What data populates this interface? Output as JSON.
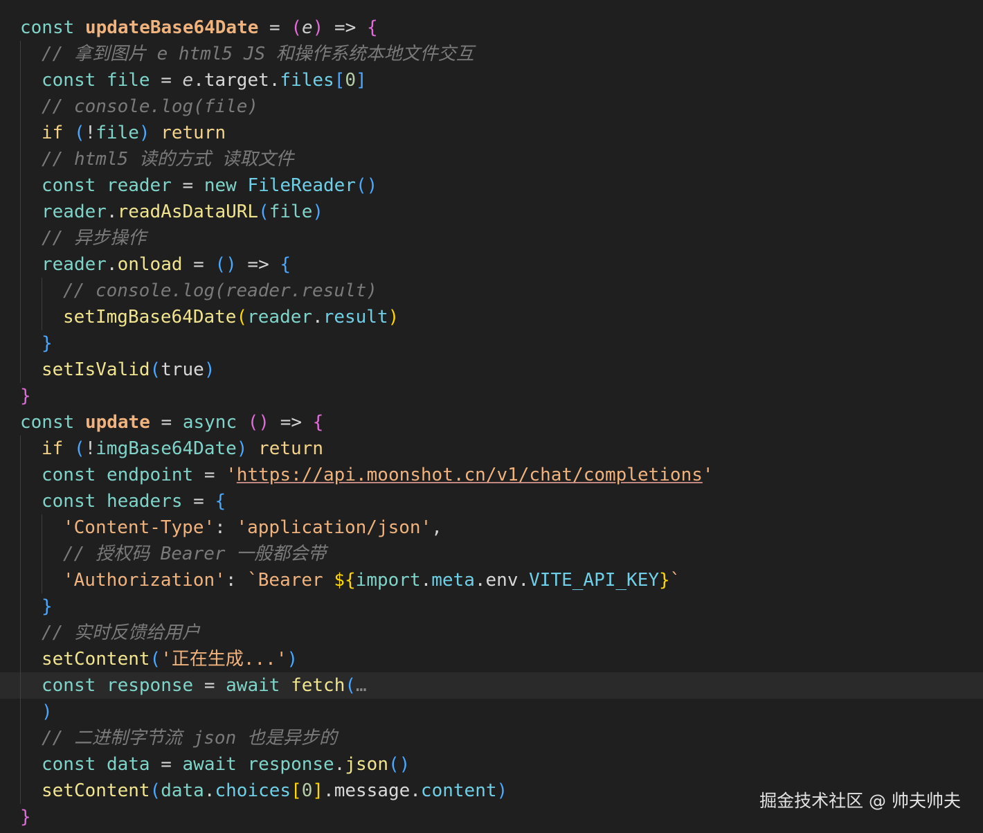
{
  "editor": {
    "lines": [
      {
        "indent": 0,
        "tokens": [
          [
            "kw-const",
            "const"
          ],
          [
            "op",
            " "
          ],
          [
            "fn-decl",
            "updateBase64Date"
          ],
          [
            "op",
            " = "
          ],
          [
            "p1",
            "("
          ],
          [
            "param",
            "e"
          ],
          [
            "p1",
            ")"
          ],
          [
            "op",
            " => "
          ],
          [
            "p1",
            "{"
          ]
        ]
      },
      {
        "indent": 1,
        "tokens": [
          [
            "cmt",
            "// 拿到图片 e html5 JS 和操作系统本地文件交互"
          ]
        ]
      },
      {
        "indent": 1,
        "tokens": [
          [
            "kw-const",
            "const"
          ],
          [
            "op",
            " "
          ],
          [
            "var",
            "file"
          ],
          [
            "op",
            " = "
          ],
          [
            "param",
            "e"
          ],
          [
            "op",
            "."
          ],
          [
            "plain",
            "target"
          ],
          [
            "op",
            "."
          ],
          [
            "prop",
            "files"
          ],
          [
            "p2",
            "["
          ],
          [
            "num",
            "0"
          ],
          [
            "p2",
            "]"
          ]
        ]
      },
      {
        "indent": 1,
        "tokens": [
          [
            "cmt",
            "// console.log(file)"
          ]
        ]
      },
      {
        "indent": 1,
        "tokens": [
          [
            "kw-ctrl",
            "if"
          ],
          [
            "op",
            " "
          ],
          [
            "p2",
            "("
          ],
          [
            "op",
            "!"
          ],
          [
            "var",
            "file"
          ],
          [
            "p2",
            ")"
          ],
          [
            "op",
            " "
          ],
          [
            "kw-ctrl",
            "return"
          ]
        ]
      },
      {
        "indent": 1,
        "tokens": [
          [
            "cmt",
            "// html5 读的方式 读取文件"
          ]
        ]
      },
      {
        "indent": 1,
        "tokens": [
          [
            "kw-const",
            "const"
          ],
          [
            "op",
            " "
          ],
          [
            "var",
            "reader"
          ],
          [
            "op",
            " = "
          ],
          [
            "kw-const",
            "new"
          ],
          [
            "op",
            " "
          ],
          [
            "cls",
            "FileReader"
          ],
          [
            "p2",
            "()"
          ]
        ]
      },
      {
        "indent": 1,
        "tokens": [
          [
            "var",
            "reader"
          ],
          [
            "op",
            "."
          ],
          [
            "fn-call",
            "readAsDataURL"
          ],
          [
            "p2",
            "("
          ],
          [
            "var",
            "file"
          ],
          [
            "p2",
            ")"
          ]
        ]
      },
      {
        "indent": 1,
        "tokens": [
          [
            "cmt",
            "// 异步操作"
          ]
        ]
      },
      {
        "indent": 1,
        "tokens": [
          [
            "var",
            "reader"
          ],
          [
            "op",
            "."
          ],
          [
            "fn-call",
            "onload"
          ],
          [
            "op",
            " = "
          ],
          [
            "p2",
            "()"
          ],
          [
            "op",
            " => "
          ],
          [
            "p2",
            "{"
          ]
        ]
      },
      {
        "indent": 2,
        "tokens": [
          [
            "cmt",
            "// console.log(reader.result)"
          ]
        ]
      },
      {
        "indent": 2,
        "tokens": [
          [
            "fn-call",
            "setImgBase64Date"
          ],
          [
            "p3",
            "("
          ],
          [
            "var",
            "reader"
          ],
          [
            "op",
            "."
          ],
          [
            "prop",
            "result"
          ],
          [
            "p3",
            ")"
          ]
        ]
      },
      {
        "indent": 1,
        "tokens": [
          [
            "p2",
            "}"
          ]
        ]
      },
      {
        "indent": 1,
        "tokens": [
          [
            "fn-call",
            "setIsValid"
          ],
          [
            "p2",
            "("
          ],
          [
            "plain",
            "true"
          ],
          [
            "p2",
            ")"
          ]
        ]
      },
      {
        "indent": 0,
        "tokens": [
          [
            "p1",
            "}"
          ]
        ]
      },
      {
        "indent": 0,
        "tokens": [
          [
            "kw-const",
            "const"
          ],
          [
            "op",
            " "
          ],
          [
            "fn-decl",
            "update"
          ],
          [
            "op",
            " = "
          ],
          [
            "kw-const",
            "async"
          ],
          [
            "op",
            " "
          ],
          [
            "p1",
            "()"
          ],
          [
            "op",
            " => "
          ],
          [
            "p1",
            "{"
          ]
        ]
      },
      {
        "indent": 1,
        "tokens": [
          [
            "kw-ctrl",
            "if"
          ],
          [
            "op",
            " "
          ],
          [
            "p2",
            "("
          ],
          [
            "op",
            "!"
          ],
          [
            "var",
            "imgBase64Date"
          ],
          [
            "p2",
            ")"
          ],
          [
            "op",
            " "
          ],
          [
            "kw-ctrl",
            "return"
          ]
        ]
      },
      {
        "indent": 1,
        "tokens": [
          [
            "kw-const",
            "const"
          ],
          [
            "op",
            " "
          ],
          [
            "var",
            "endpoint"
          ],
          [
            "op",
            " = "
          ],
          [
            "str",
            "'"
          ],
          [
            "url",
            "https://api.moonshot.cn/v1/chat/completions"
          ],
          [
            "str",
            "'"
          ]
        ]
      },
      {
        "indent": 1,
        "tokens": [
          [
            "kw-const",
            "const"
          ],
          [
            "op",
            " "
          ],
          [
            "var",
            "headers"
          ],
          [
            "op",
            " = "
          ],
          [
            "p2",
            "{"
          ]
        ]
      },
      {
        "indent": 2,
        "tokens": [
          [
            "str",
            "'Content-Type'"
          ],
          [
            "op",
            ": "
          ],
          [
            "str",
            "'application/json'"
          ],
          [
            "op",
            ","
          ]
        ]
      },
      {
        "indent": 2,
        "tokens": [
          [
            "cmt",
            "// 授权码 Bearer 一般都会带"
          ]
        ]
      },
      {
        "indent": 2,
        "tokens": [
          [
            "str",
            "'Authorization'"
          ],
          [
            "op",
            ": "
          ],
          [
            "str",
            "`Bearer "
          ],
          [
            "p3",
            "${"
          ],
          [
            "var",
            "import"
          ],
          [
            "op",
            "."
          ],
          [
            "prop",
            "meta"
          ],
          [
            "op",
            "."
          ],
          [
            "plain",
            "env"
          ],
          [
            "op",
            "."
          ],
          [
            "prop",
            "VITE_API_KEY"
          ],
          [
            "p3",
            "}"
          ],
          [
            "str",
            "`"
          ]
        ]
      },
      {
        "indent": 1,
        "tokens": [
          [
            "p2",
            "}"
          ]
        ]
      },
      {
        "indent": 1,
        "tokens": [
          [
            "cmt",
            "// 实时反馈给用户"
          ]
        ]
      },
      {
        "indent": 1,
        "tokens": [
          [
            "fn-call",
            "setContent"
          ],
          [
            "p2",
            "("
          ],
          [
            "str",
            "'正在生成...'"
          ],
          [
            "p2",
            ")"
          ]
        ]
      },
      {
        "indent": 1,
        "highlight": true,
        "tokens": [
          [
            "kw-const",
            "const"
          ],
          [
            "op",
            " "
          ],
          [
            "var",
            "response"
          ],
          [
            "op",
            " = "
          ],
          [
            "kw-const",
            "await"
          ],
          [
            "op",
            " "
          ],
          [
            "fn-call",
            "fetch"
          ],
          [
            "p2",
            "("
          ],
          [
            "ellipsis",
            "…"
          ]
        ]
      },
      {
        "indent": 1,
        "tokens": [
          [
            "p2",
            ")"
          ]
        ]
      },
      {
        "indent": 1,
        "tokens": [
          [
            "cmt",
            "// 二进制字节流 json 也是异步的"
          ]
        ]
      },
      {
        "indent": 1,
        "tokens": [
          [
            "kw-const",
            "const"
          ],
          [
            "op",
            " "
          ],
          [
            "var",
            "data"
          ],
          [
            "op",
            " = "
          ],
          [
            "kw-const",
            "await"
          ],
          [
            "op",
            " "
          ],
          [
            "var",
            "response"
          ],
          [
            "op",
            "."
          ],
          [
            "fn-call",
            "json"
          ],
          [
            "p2",
            "()"
          ]
        ]
      },
      {
        "indent": 1,
        "tokens": [
          [
            "fn-call",
            "setContent"
          ],
          [
            "p2",
            "("
          ],
          [
            "var",
            "data"
          ],
          [
            "op",
            "."
          ],
          [
            "prop",
            "choices"
          ],
          [
            "p3",
            "["
          ],
          [
            "num",
            "0"
          ],
          [
            "p3",
            "]"
          ],
          [
            "op",
            "."
          ],
          [
            "plain",
            "message"
          ],
          [
            "op",
            "."
          ],
          [
            "prop",
            "content"
          ],
          [
            "p2",
            ")"
          ]
        ]
      },
      {
        "indent": 0,
        "tokens": [
          [
            "p1",
            "}"
          ]
        ]
      }
    ]
  },
  "watermark": "掘金技术社区 @ 帅夫帅夫"
}
